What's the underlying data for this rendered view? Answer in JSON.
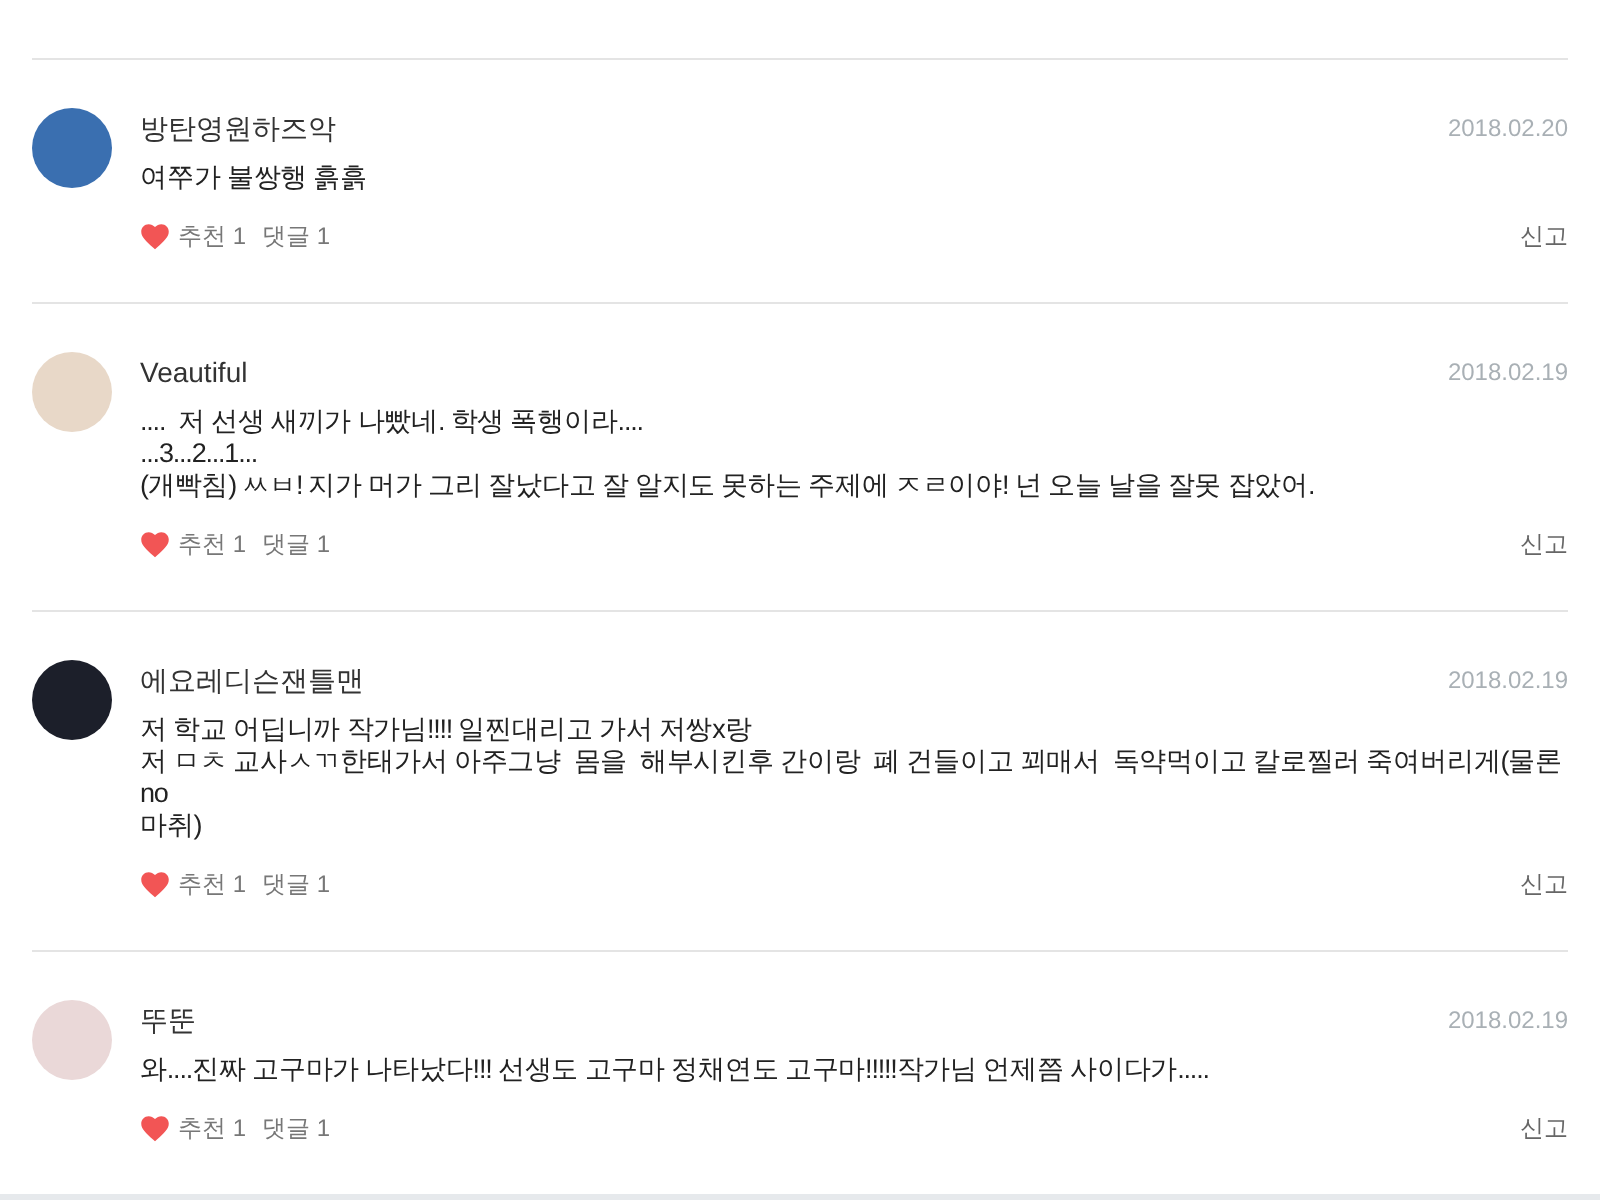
{
  "comments": [
    {
      "author": "방탄영원하즈악",
      "date": "2018.02.20",
      "body": [
        "여쭈가 불쌍행 흙흙"
      ],
      "likes": "추천 1",
      "replies": "댓글 1",
      "report": "신고"
    },
    {
      "author": "Veautiful",
      "date": "2018.02.19",
      "body": [
        "....  저 선생 새끼가 나빴네. 학생 폭행이라....",
        "...3...2...1...",
        "(개빡침) ㅆㅂ! 지가 머가 그리 잘났다고 잘 알지도 못하는 주제에 ㅈㄹ이야! 넌 오늘 날을 잘못 잡았어."
      ],
      "likes": "추천 1",
      "replies": "댓글 1",
      "report": "신고"
    },
    {
      "author": "에요레디슨잰틀맨",
      "date": "2018.02.19",
      "body": [
        "저 학교 어딥니까 작가님!!!! 일찐대리고 가서 저쌍x랑",
        "저 ㅁㅊ 교사ㅅㄲ한태가서 아주그냥  몸을  해부시킨후 간이랑  폐 건들이고 꾀매서  독약먹이고 칼로찔러 죽여버리게(물론 no",
        "마취)"
      ],
      "likes": "추천 1",
      "replies": "댓글 1",
      "report": "신고"
    },
    {
      "author": "뚜뚠",
      "date": "2018.02.19",
      "body": [
        "와....진짜 고구마가 나타났다!!! 선생도 고구마 정채연도 고구마!!!!!작가님 언제쯤 사이다가....."
      ],
      "likes": "추천 1",
      "replies": "댓글 1",
      "report": "신고"
    }
  ]
}
